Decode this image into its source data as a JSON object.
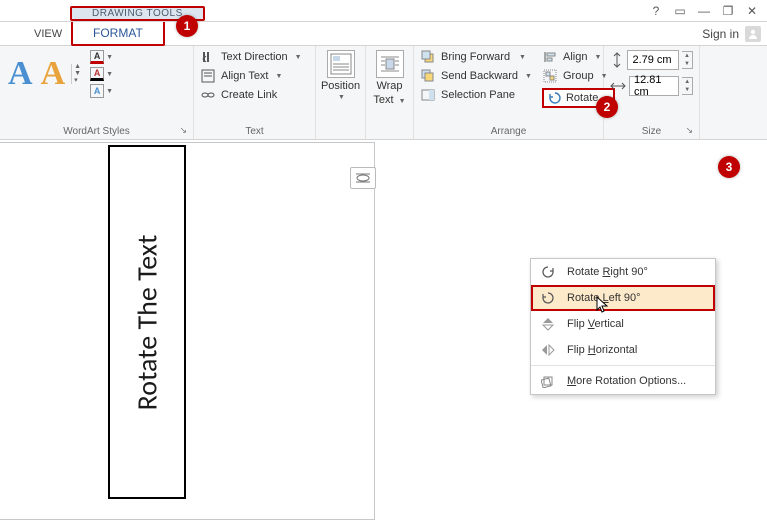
{
  "titlebar": {
    "context_tab_group": "DRAWING TOOLS",
    "help": "?",
    "ribbon_display": "▭",
    "minimize": "—",
    "restore": "❐",
    "close": "✕"
  },
  "tabs": {
    "view": "VIEW",
    "format": "FORMAT",
    "signin": "Sign in"
  },
  "badges": {
    "b1": "1",
    "b2": "2",
    "b3": "3"
  },
  "ribbon": {
    "wordart": {
      "label": "WordArt Styles",
      "sample": "A",
      "fill_icon": "A",
      "outline_icon": "A",
      "effects_icon": "A"
    },
    "text": {
      "label": "Text",
      "direction": "Text Direction",
      "align": "Align Text",
      "link": "Create Link"
    },
    "position": {
      "label": "Position"
    },
    "wrap": {
      "label": "Wrap",
      "label2": "Text"
    },
    "arrange": {
      "label": "Arrange",
      "forward": "Bring Forward",
      "backward": "Send Backward",
      "selection": "Selection Pane",
      "align": "Align",
      "group": "Group",
      "rotate": "Rotate"
    },
    "size": {
      "label": "Size",
      "height": "2.79 cm",
      "width": "12.81 cm"
    }
  },
  "menu": {
    "rotate_right": {
      "text": "Rotate ",
      "u": "R",
      "rest": "ight 90°"
    },
    "rotate_left": {
      "text": "Rotate ",
      "u": "L",
      "rest": "eft 90°"
    },
    "flip_v": {
      "text": "Flip ",
      "u": "V",
      "rest": "ertical"
    },
    "flip_h": {
      "text": "Flip ",
      "u": "H",
      "rest": "orizontal"
    },
    "more": {
      "u": "M",
      "rest": "ore Rotation Options..."
    }
  },
  "document": {
    "textbox_content": "Rotate The Text"
  }
}
